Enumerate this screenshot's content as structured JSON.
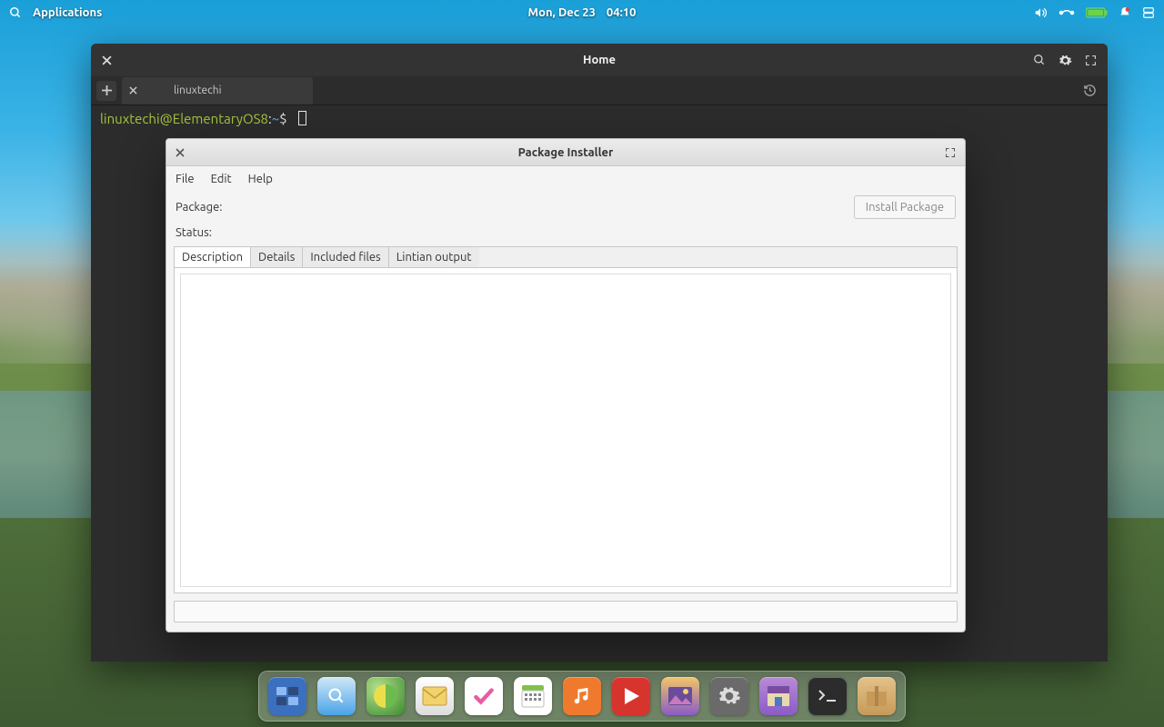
{
  "panel": {
    "apps_label": "Applications",
    "date": "Mon, Dec 23",
    "time": "04:10"
  },
  "terminal": {
    "title": "Home",
    "tab_label": "linuxtechi",
    "prompt": {
      "user": "linuxtechi",
      "at": "@",
      "host": "ElementaryOS8",
      "sep1": ":",
      "path": "~",
      "symbol": "$"
    }
  },
  "pkg": {
    "title": "Package Installer",
    "menu": {
      "file": "File",
      "edit": "Edit",
      "help": "Help"
    },
    "package_label": "Package:",
    "status_label": "Status:",
    "install_button": "Install Package",
    "tabs": {
      "description": "Description",
      "details": "Details",
      "included": "Included files",
      "lintian": "Lintian output"
    }
  },
  "dock": {
    "items": [
      {
        "name": "multitasking",
        "bg": "#3b6fbf"
      },
      {
        "name": "files",
        "bg": "#4aa3e8"
      },
      {
        "name": "web-browser",
        "bg": "#6dbb4e"
      },
      {
        "name": "mail",
        "bg": "#f2b23c"
      },
      {
        "name": "tasks",
        "bg": "#e85ca0"
      },
      {
        "name": "calendar",
        "bg": "#7dc24a"
      },
      {
        "name": "music",
        "bg": "#ef7a2e"
      },
      {
        "name": "videos",
        "bg": "#d8342e"
      },
      {
        "name": "photos",
        "bg": "#8a5cc6"
      },
      {
        "name": "settings",
        "bg": "#6a6a6a"
      },
      {
        "name": "app-center",
        "bg": "#8a5cc6"
      },
      {
        "name": "terminal",
        "bg": "#2c2c2c"
      },
      {
        "name": "package",
        "bg": "#c79a5a"
      }
    ]
  }
}
